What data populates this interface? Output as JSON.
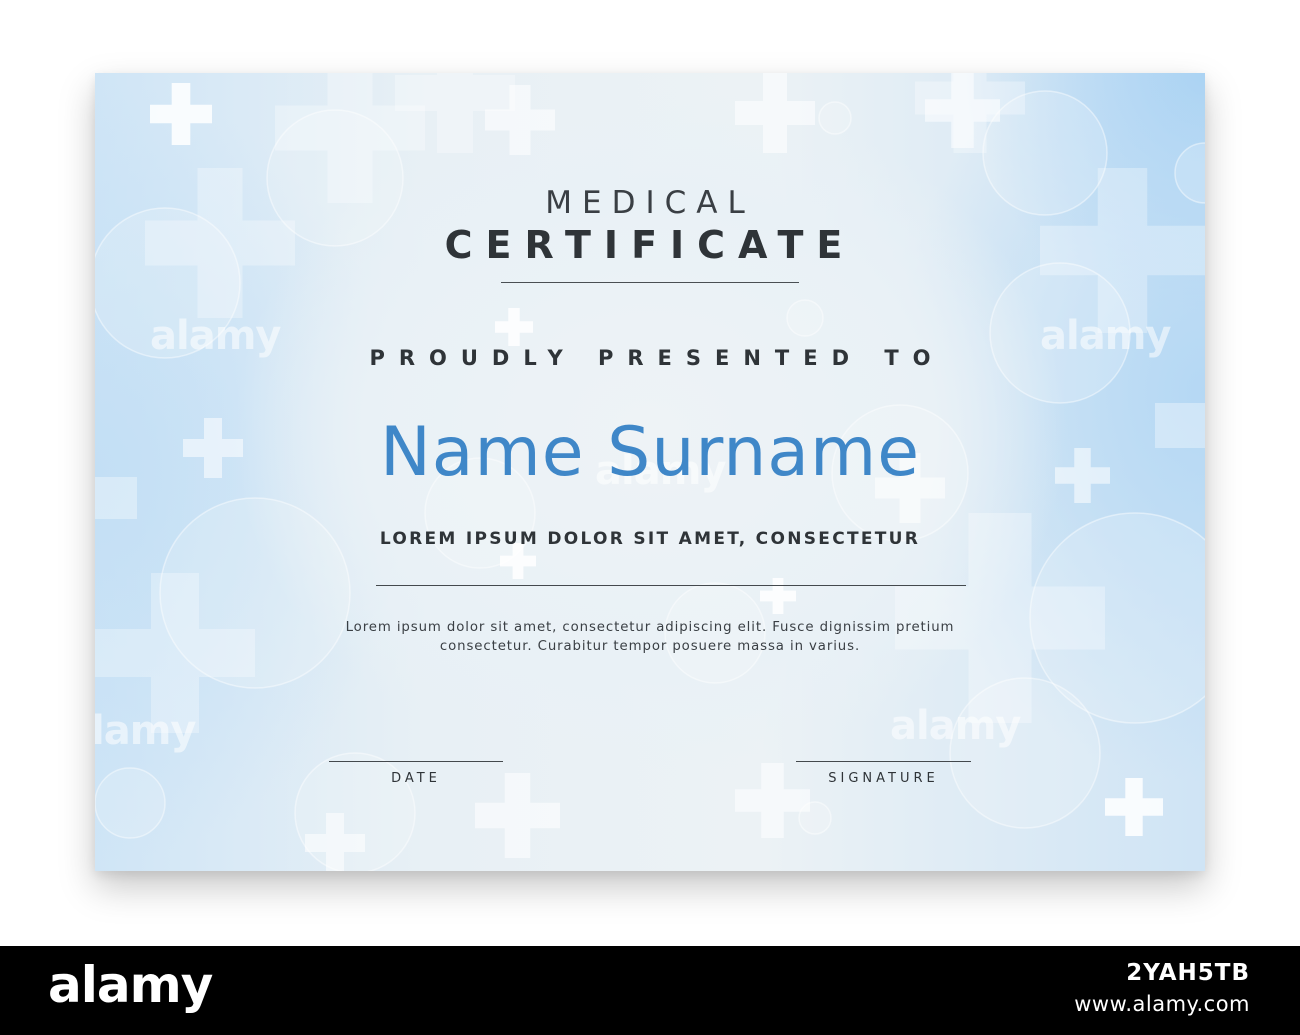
{
  "certificate": {
    "title_top": "MEDICAL",
    "title_main": "CERTIFICATE",
    "presented_line": "PROUDLY PRESENTED TO",
    "recipient_name": "Name Surname",
    "subtitle": "LOREM IPSUM DOLOR SIT AMET, CONSECTETUR",
    "body_line_1": "Lorem ipsum dolor sit amet, consectetur adipiscing elit. Fusce dignissim pretium",
    "body_line_2": "consectetur. Curabitur tempor posuere massa in varius.",
    "date_label": "DATE",
    "signature_label": "SIGNATURE"
  },
  "watermark": {
    "text": "alamy"
  },
  "brand_bar": {
    "logo": "alamy",
    "image_id": "2YAH5TB",
    "url": "www.alamy.com"
  },
  "colors": {
    "accent_name": "#3f87c8",
    "text_dark": "#2f3438",
    "background_light": "#ecf2f5",
    "background_blue": "#b5d8f4"
  },
  "icons": [
    "medical-cross-icon",
    "bokeh-circle-decoration"
  ]
}
